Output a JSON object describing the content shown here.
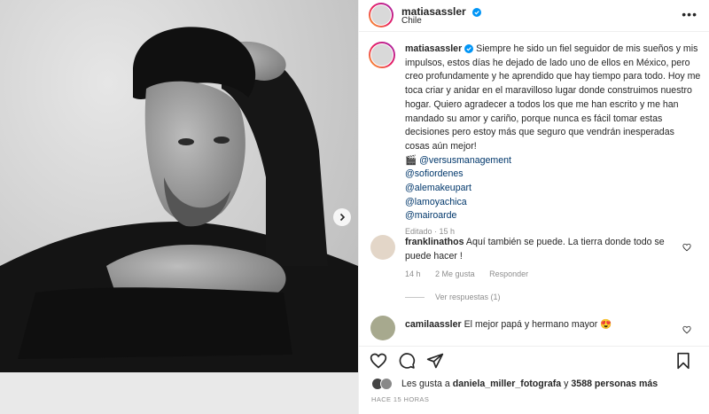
{
  "post": {
    "author": "matiasassler",
    "location": "Chile",
    "caption": "Siempre he sido un fiel seguidor de mis sueños y mis impulsos, estos días he dejado de lado uno de ellos en México, pero creo profundamente y he aprendido que hay tiempo para todo. Hoy me toca criar y anidar en el maravilloso lugar donde construimos nuestro hogar. Quiero agradecer a todos los que me han escrito y me han mandado su amor y cariño, porque nunca es fácil tomar estas decisiones pero estoy más que seguro que vendrán inesperadas cosas aún mejor!",
    "clapper_emoji": "🎬",
    "mentions": [
      "@versusmanagement",
      "@sofiordenes",
      "@alemakeupart",
      "@lamoyachica",
      "@mairoarde"
    ],
    "edited_label": "Editado · 15 h"
  },
  "comments": [
    {
      "username": "franklinathos",
      "text": "Aquí también se puede. La tierra donde todo se puede hacer !",
      "time": "14 h",
      "likes": "2 Me gusta",
      "reply_label": "Responder",
      "view_replies": "Ver respuestas (1)"
    },
    {
      "username": "camilaassler",
      "text": "El mejor papá y hermano mayor 😍"
    }
  ],
  "likes": {
    "prefix": "Les gusta a",
    "user": "daniela_miller_fotografa",
    "middle": "y",
    "count": "3588 personas más"
  },
  "timestamp": "HACE 15 HORAS",
  "icons": [
    "verified-icon",
    "more-icon",
    "heart-icon",
    "comment-icon",
    "share-icon",
    "bookmark-icon",
    "chevron-right-icon"
  ],
  "colors": {
    "link": "#00376b",
    "verified": "#0095f6",
    "muted": "#8e8e8e"
  }
}
